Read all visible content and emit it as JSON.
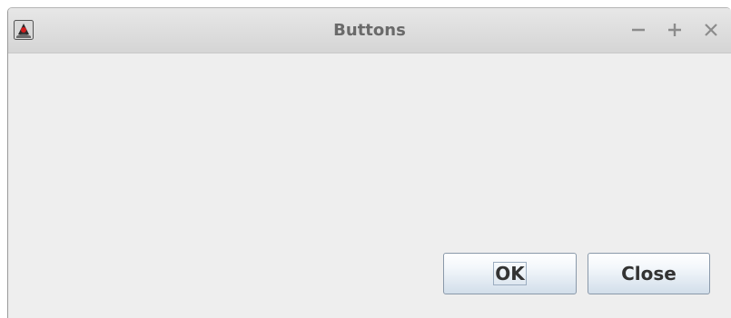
{
  "window": {
    "title": "Buttons",
    "icon": "java-duke-icon",
    "controls": {
      "minimize": "minimize-icon",
      "maximize": "maximize-icon",
      "close": "close-icon"
    }
  },
  "buttons": {
    "ok_label": "OK",
    "close_label": "Close"
  },
  "colors": {
    "background": "#eeeeee",
    "title_text": "#6a6a6a",
    "button_border": "#8a99aa",
    "button_gradient_bottom": "#d2deea"
  }
}
